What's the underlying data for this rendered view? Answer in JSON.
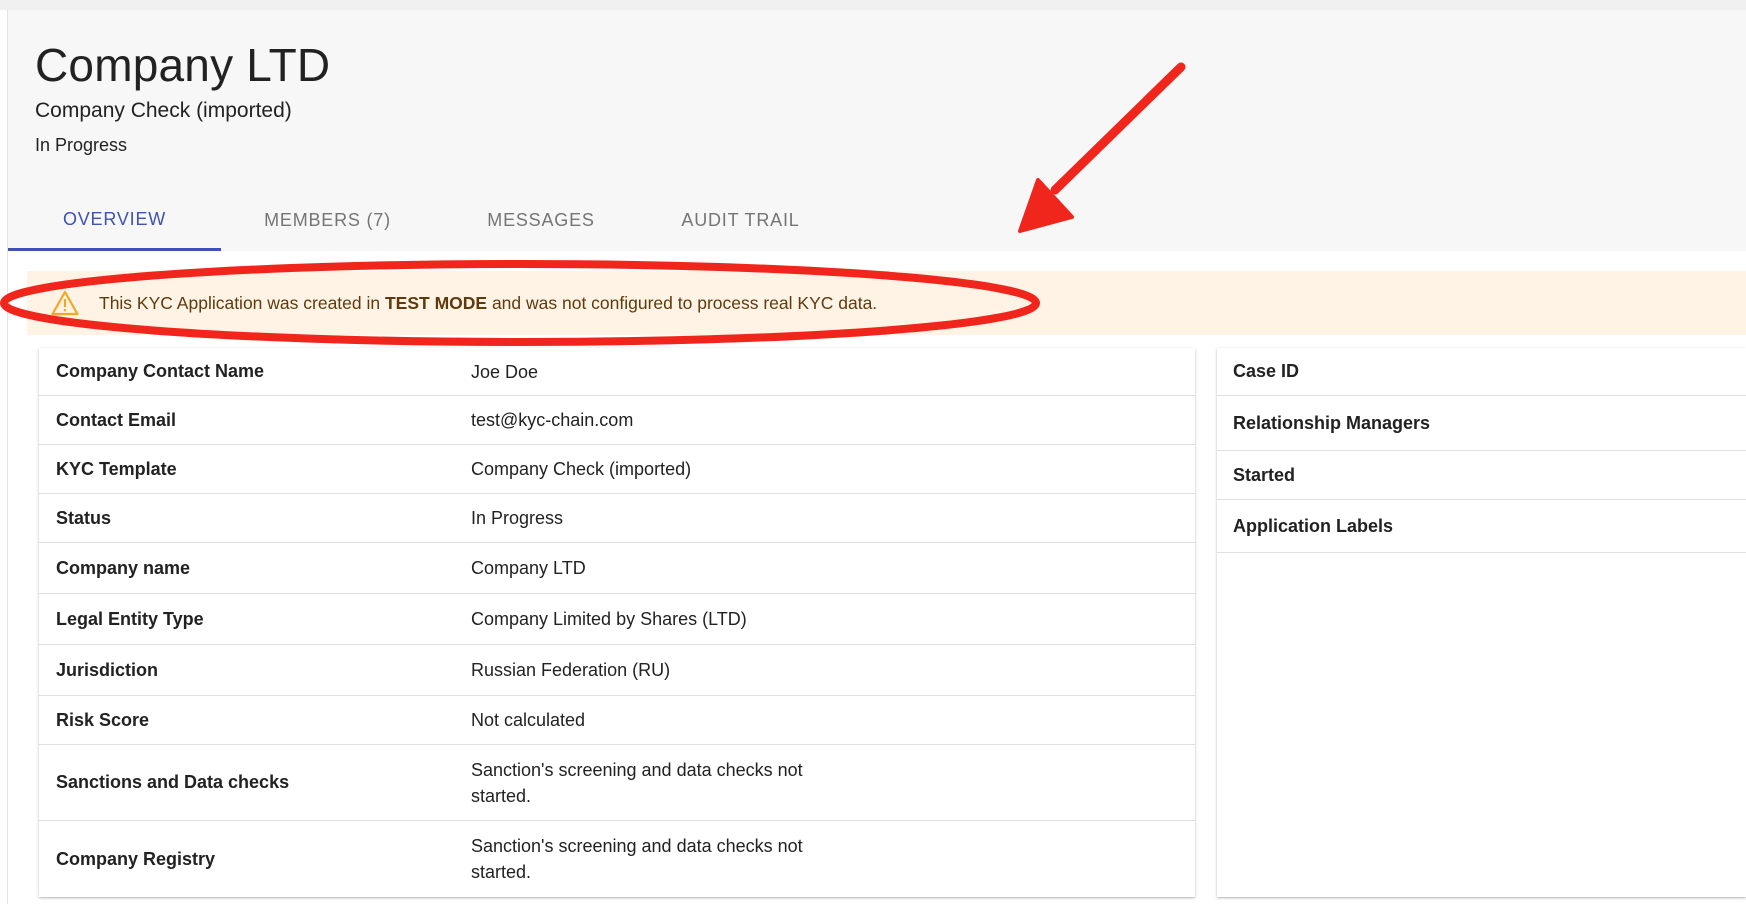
{
  "header": {
    "title": "Company LTD",
    "subtitle": "Company Check (imported)",
    "status": "In Progress"
  },
  "tabs": [
    {
      "label": "OVERVIEW",
      "active": true
    },
    {
      "label": "MEMBERS (7)",
      "active": false
    },
    {
      "label": "MESSAGES",
      "active": false
    },
    {
      "label": "AUDIT TRAIL",
      "active": false
    }
  ],
  "banner": {
    "icon": "warning-icon",
    "text_before": "This KYC Application was created in ",
    "text_bold": "TEST MODE",
    "text_after": " and was not configured to process real KYC data."
  },
  "details": [
    {
      "label": "Company Contact Name",
      "value": "Joe Doe"
    },
    {
      "label": "Contact Email",
      "value": "test@kyc-chain.com"
    },
    {
      "label": "KYC Template",
      "value": "Company Check (imported)"
    },
    {
      "label": "Status",
      "value": "In Progress"
    },
    {
      "label": "Company name",
      "value": "Company LTD"
    },
    {
      "label": "Legal Entity Type",
      "value": "Company Limited by Shares (LTD)"
    },
    {
      "label": "Jurisdiction",
      "value": "Russian Federation (RU)"
    },
    {
      "label": "Risk Score",
      "value": "Not calculated"
    },
    {
      "label": "Sanctions and Data checks",
      "value": "Sanction's screening and data checks not started."
    },
    {
      "label": "Company Registry",
      "value": "Sanction's screening and data checks not started."
    }
  ],
  "side_panel": [
    {
      "label": "Case ID"
    },
    {
      "label": "Relationship Managers"
    },
    {
      "label": "Started"
    },
    {
      "label": "Application Labels"
    }
  ],
  "colors": {
    "accent": "#3f51b5",
    "banner_bg": "#fff3e5",
    "banner_text": "#5f3a0d",
    "warning_icon": "#f5a623",
    "annotation_red": "#f0261c"
  }
}
